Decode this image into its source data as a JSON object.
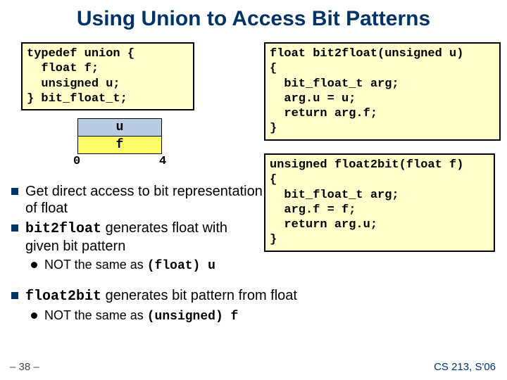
{
  "title": "Using Union to Access Bit Patterns",
  "code_left": "typedef union {\n  float f;\n  unsigned u;\n} bit_float_t;",
  "code_right_top": "float bit2float(unsigned u)\n{\n  bit_float_t arg;\n  arg.u = u;\n  return arg.f;\n}",
  "code_right_bottom": "unsigned float2bit(float f)\n{\n  bit_float_t arg;\n  arg.f = f;\n  return arg.u;\n}",
  "diagram": {
    "row_u": "u",
    "row_f": "f",
    "tick_left": "0",
    "tick_right": "4"
  },
  "bullets": {
    "b1a": "Get direct access to bit representation of float",
    "b1b_pre": "bit2float",
    "b1b_post": " generates float with given bit pattern",
    "b2b_pre": "NOT the same as ",
    "b2b_code": "(float) u",
    "b1c_pre": "float2bit",
    "b1c_post": " generates bit pattern from float",
    "b2c_pre": "NOT the same as ",
    "b2c_code": "(unsigned) f"
  },
  "footer": {
    "left": "– 38 –",
    "right": "CS 213, S'06"
  }
}
